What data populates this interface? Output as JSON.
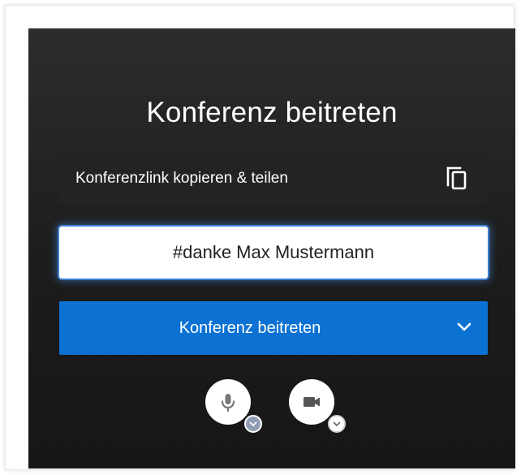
{
  "dialog": {
    "title": "Konferenz beitreten"
  },
  "share": {
    "label": "Konferenzlink kopieren & teilen",
    "icon": "copy-icon"
  },
  "name_input": {
    "value": "#danke Max Mustermann"
  },
  "join_button": {
    "label": "Konferenz beitreten",
    "icon": "chevron-down-icon"
  },
  "media": {
    "microphone_icon": "microphone-icon",
    "camera_icon": "video-camera-icon"
  },
  "colors": {
    "panel_background": "#1c1c1c",
    "accent": "#0b72d3",
    "focus_glow": "#3b7fd0",
    "text_light": "#ffffff",
    "mic_badge": "#8f9db2"
  }
}
